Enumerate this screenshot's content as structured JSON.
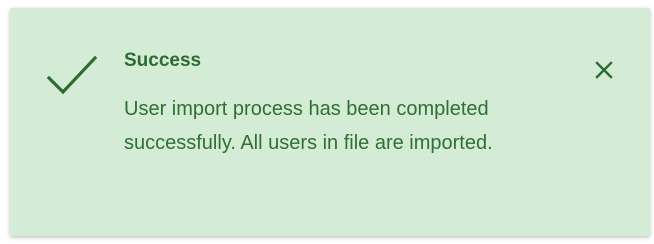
{
  "toast": {
    "status": "success",
    "title": "Success",
    "message": "User import process has been completed successfully. All users in file are imported.",
    "icon": "check-icon",
    "close_icon": "close-icon",
    "colors": {
      "background": "#d4ebd6",
      "text": "#2f7034",
      "icon": "#2e6b32"
    }
  }
}
